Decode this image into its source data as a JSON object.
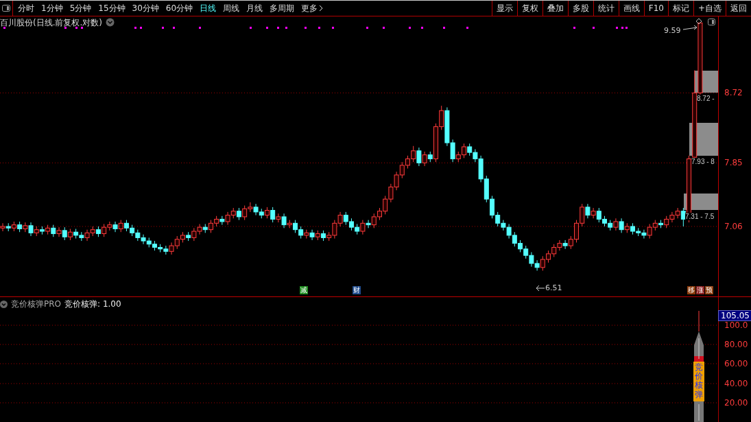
{
  "toolbar": {
    "periods": [
      {
        "label": "分时",
        "selected": false
      },
      {
        "label": "1分钟",
        "selected": false
      },
      {
        "label": "5分钟",
        "selected": false
      },
      {
        "label": "15分钟",
        "selected": false
      },
      {
        "label": "30分钟",
        "selected": false
      },
      {
        "label": "60分钟",
        "selected": false
      },
      {
        "label": "日线",
        "selected": true
      },
      {
        "label": "周线",
        "selected": false
      },
      {
        "label": "月线",
        "selected": false
      },
      {
        "label": "多周期",
        "selected": false
      },
      {
        "label": "更多",
        "selected": false
      }
    ],
    "buttons": [
      "显示",
      "复权",
      "叠加",
      "多股",
      "统计",
      "画线",
      "F10",
      "标记",
      "+自选",
      "返回"
    ]
  },
  "main_chart": {
    "title": "百川股份(日线.前复权.对数)",
    "chart_data": {
      "type": "candlestick",
      "grid": true,
      "ylim": [
        6.19,
        9.67
      ],
      "yticks": [
        {
          "value": 8.72,
          "label": "8.72"
        },
        {
          "value": 7.85,
          "label": "7.85"
        },
        {
          "value": 7.06,
          "label": "7.06"
        }
      ],
      "categories": [
        null,
        null,
        null,
        null,
        null,
        null,
        null,
        null,
        null,
        null,
        null,
        null,
        null,
        null,
        null,
        null,
        null,
        null,
        null,
        null,
        null,
        null,
        null,
        null,
        null,
        null,
        null,
        null,
        null,
        null,
        null,
        null,
        null,
        null,
        null,
        null,
        null,
        null,
        null,
        null,
        null,
        null,
        null,
        null,
        null,
        null,
        null,
        null,
        null,
        null,
        null,
        null,
        null,
        null,
        null,
        null,
        null,
        null,
        null,
        null,
        null,
        null,
        null,
        null,
        null,
        null,
        null,
        null,
        null,
        null,
        null,
        null,
        null,
        null,
        null,
        null,
        null,
        null,
        null,
        null,
        null,
        null,
        null,
        null,
        null,
        null,
        null,
        null,
        null,
        null,
        null,
        null,
        null,
        null,
        null,
        null,
        null,
        null,
        null,
        null,
        null,
        null,
        null,
        null,
        null,
        null,
        null,
        null,
        null,
        null,
        null,
        null,
        null,
        null,
        null,
        null,
        null,
        null,
        null,
        null,
        null,
        null,
        null,
        null,
        null
      ],
      "ohlc": [
        [
          7.04,
          7.1,
          7.0,
          7.06
        ],
        [
          7.06,
          7.1,
          7.0,
          7.04
        ],
        [
          7.04,
          7.12,
          7.0,
          7.08
        ],
        [
          7.08,
          7.12,
          6.99,
          7.03
        ],
        [
          7.03,
          7.11,
          6.99,
          7.07
        ],
        [
          7.07,
          7.11,
          6.94,
          6.98
        ],
        [
          6.98,
          7.06,
          6.94,
          7.02
        ],
        [
          7.02,
          7.06,
          6.96,
          7.0
        ],
        [
          7.0,
          7.08,
          6.96,
          7.04
        ],
        [
          7.04,
          7.08,
          6.93,
          6.97
        ],
        [
          6.97,
          7.05,
          6.93,
          7.01
        ],
        [
          7.01,
          7.05,
          6.89,
          6.93
        ],
        [
          6.93,
          7.03,
          6.89,
          6.99
        ],
        [
          6.99,
          7.03,
          6.91,
          6.95
        ],
        [
          6.95,
          6.99,
          6.88,
          6.92
        ],
        [
          6.92,
          7.02,
          6.88,
          6.98
        ],
        [
          6.98,
          7.06,
          6.94,
          7.02
        ],
        [
          7.02,
          7.06,
          6.93,
          6.97
        ],
        [
          6.97,
          7.09,
          6.93,
          7.05
        ],
        [
          7.05,
          7.12,
          7.01,
          7.08
        ],
        [
          7.08,
          7.12,
          6.99,
          7.03
        ],
        [
          7.03,
          7.14,
          6.99,
          7.1
        ],
        [
          7.1,
          7.14,
          7.0,
          7.04
        ],
        [
          7.04,
          7.08,
          6.94,
          6.98
        ],
        [
          6.98,
          7.02,
          6.88,
          6.92
        ],
        [
          6.92,
          6.96,
          6.84,
          6.88
        ],
        [
          6.88,
          6.92,
          6.8,
          6.84
        ],
        [
          6.84,
          6.88,
          6.76,
          6.8
        ],
        [
          6.8,
          6.84,
          6.74,
          6.78
        ],
        [
          6.78,
          6.82,
          6.71,
          6.75
        ],
        [
          6.75,
          6.86,
          6.71,
          6.82
        ],
        [
          6.82,
          6.94,
          6.78,
          6.9
        ],
        [
          6.9,
          6.99,
          6.86,
          6.95
        ],
        [
          6.95,
          6.99,
          6.88,
          6.92
        ],
        [
          6.92,
          7.04,
          6.88,
          7.0
        ],
        [
          7.0,
          7.09,
          6.96,
          7.05
        ],
        [
          7.05,
          7.09,
          6.98,
          7.02
        ],
        [
          7.02,
          7.14,
          6.98,
          7.1
        ],
        [
          7.1,
          7.19,
          7.06,
          7.15
        ],
        [
          7.15,
          7.19,
          7.08,
          7.12
        ],
        [
          7.12,
          7.24,
          7.08,
          7.2
        ],
        [
          7.2,
          7.29,
          7.16,
          7.25
        ],
        [
          7.25,
          7.29,
          7.14,
          7.18
        ],
        [
          7.18,
          7.32,
          7.14,
          7.28
        ],
        [
          7.28,
          7.36,
          7.24,
          7.3
        ],
        [
          7.3,
          7.34,
          7.2,
          7.24
        ],
        [
          7.24,
          7.28,
          7.16,
          7.2
        ],
        [
          7.2,
          7.3,
          7.16,
          7.26
        ],
        [
          7.26,
          7.3,
          7.11,
          7.15
        ],
        [
          7.15,
          7.22,
          7.11,
          7.18
        ],
        [
          7.18,
          7.22,
          7.04,
          7.08
        ],
        [
          7.08,
          7.14,
          7.04,
          7.1
        ],
        [
          7.1,
          7.14,
          6.98,
          7.02
        ],
        [
          7.02,
          7.06,
          6.91,
          6.95
        ],
        [
          6.95,
          7.02,
          6.91,
          6.98
        ],
        [
          6.98,
          7.02,
          6.89,
          6.93
        ],
        [
          6.93,
          7.01,
          6.89,
          6.97
        ],
        [
          6.97,
          7.01,
          6.88,
          6.92
        ],
        [
          6.92,
          6.99,
          6.88,
          6.95
        ],
        [
          6.95,
          7.14,
          6.91,
          7.1
        ],
        [
          7.1,
          7.24,
          7.06,
          7.2
        ],
        [
          7.2,
          7.24,
          7.08,
          7.12
        ],
        [
          7.12,
          7.16,
          7.01,
          7.05
        ],
        [
          7.05,
          7.09,
          6.96,
          7.0
        ],
        [
          7.0,
          7.14,
          6.96,
          7.1
        ],
        [
          7.1,
          7.14,
          7.04,
          7.08
        ],
        [
          7.08,
          7.22,
          7.04,
          7.18
        ],
        [
          7.18,
          7.29,
          7.14,
          7.25
        ],
        [
          7.25,
          7.44,
          7.21,
          7.4
        ],
        [
          7.4,
          7.59,
          7.36,
          7.55
        ],
        [
          7.55,
          7.74,
          7.51,
          7.7
        ],
        [
          7.7,
          7.86,
          7.66,
          7.82
        ],
        [
          7.82,
          7.94,
          7.78,
          7.9
        ],
        [
          7.9,
          8.06,
          7.86,
          8.0
        ],
        [
          8.0,
          8.04,
          7.81,
          7.85
        ],
        [
          7.85,
          7.99,
          7.81,
          7.95
        ],
        [
          7.95,
          7.99,
          7.86,
          7.9
        ],
        [
          7.9,
          8.34,
          7.86,
          8.3
        ],
        [
          8.3,
          8.56,
          8.26,
          8.5
        ],
        [
          8.5,
          8.54,
          8.06,
          8.1
        ],
        [
          8.1,
          8.14,
          7.86,
          7.9
        ],
        [
          7.9,
          7.99,
          7.86,
          7.95
        ],
        [
          7.95,
          8.09,
          7.91,
          8.05
        ],
        [
          8.05,
          8.09,
          7.94,
          7.98
        ],
        [
          7.98,
          8.02,
          7.86,
          7.9
        ],
        [
          7.9,
          7.94,
          7.61,
          7.65
        ],
        [
          7.65,
          7.69,
          7.36,
          7.4
        ],
        [
          7.4,
          7.44,
          7.16,
          7.2
        ],
        [
          7.2,
          7.24,
          7.06,
          7.1
        ],
        [
          7.1,
          7.14,
          7.01,
          7.05
        ],
        [
          7.05,
          7.09,
          6.91,
          6.95
        ],
        [
          6.95,
          6.99,
          6.81,
          6.85
        ],
        [
          6.85,
          6.89,
          6.74,
          6.78
        ],
        [
          6.78,
          6.82,
          6.66,
          6.7
        ],
        [
          6.7,
          6.74,
          6.56,
          6.6
        ],
        [
          6.6,
          6.64,
          6.51,
          6.55
        ],
        [
          6.55,
          6.69,
          6.51,
          6.65
        ],
        [
          6.65,
          6.76,
          6.61,
          6.72
        ],
        [
          6.72,
          6.84,
          6.68,
          6.8
        ],
        [
          6.8,
          6.89,
          6.76,
          6.85
        ],
        [
          6.85,
          6.89,
          6.78,
          6.82
        ],
        [
          6.82,
          6.94,
          6.78,
          6.9
        ],
        [
          6.9,
          7.14,
          6.86,
          7.1
        ],
        [
          7.1,
          7.34,
          7.06,
          7.3
        ],
        [
          7.3,
          7.34,
          7.16,
          7.2
        ],
        [
          7.2,
          7.29,
          7.16,
          7.25
        ],
        [
          7.25,
          7.29,
          7.11,
          7.15
        ],
        [
          7.15,
          7.19,
          7.06,
          7.1
        ],
        [
          7.1,
          7.14,
          7.01,
          7.05
        ],
        [
          7.05,
          7.16,
          7.01,
          7.12
        ],
        [
          7.12,
          7.16,
          6.98,
          7.02
        ],
        [
          7.02,
          7.1,
          6.98,
          7.06
        ],
        [
          7.06,
          7.1,
          6.96,
          7.0
        ],
        [
          7.0,
          7.04,
          6.94,
          6.98
        ],
        [
          6.98,
          7.02,
          6.91,
          6.95
        ],
        [
          6.95,
          7.09,
          6.91,
          7.05
        ],
        [
          7.05,
          7.14,
          7.01,
          7.1
        ],
        [
          7.1,
          7.14,
          7.04,
          7.08
        ],
        [
          7.08,
          7.19,
          7.04,
          7.15
        ],
        [
          7.15,
          7.24,
          7.11,
          7.2
        ],
        [
          7.2,
          7.29,
          7.16,
          7.25
        ],
        [
          7.25,
          7.29,
          7.06,
          7.15
        ],
        [
          7.15,
          7.94,
          7.11,
          7.9
        ],
        [
          7.92,
          9.0,
          7.9,
          8.72
        ],
        [
          8.72,
          9.59,
          8.7,
          9.59
        ]
      ]
    },
    "zones": [
      "8.72 -",
      "7.93 - 8",
      "7.31 - 7.5"
    ],
    "high_label": "9.59",
    "low_label": "6.51",
    "badges": [
      {
        "text": "减",
        "color": "#1e8c1e"
      },
      {
        "text": "财",
        "color": "#1e4a8c"
      },
      {
        "text": "移",
        "color": "#8c3a0a"
      },
      {
        "text": "涨",
        "color": "#8c1e1e"
      },
      {
        "text": "预",
        "color": "#8c3a0a"
      }
    ]
  },
  "indicator": {
    "name": "竞价核弹PRO",
    "value_label": "竞价核弹: 1.00",
    "current_value": "105.05",
    "axis_labels": [
      "100.0",
      "80.00",
      "60.00",
      "40.00",
      "20.00"
    ],
    "rocket_label": "竞价核弹"
  }
}
